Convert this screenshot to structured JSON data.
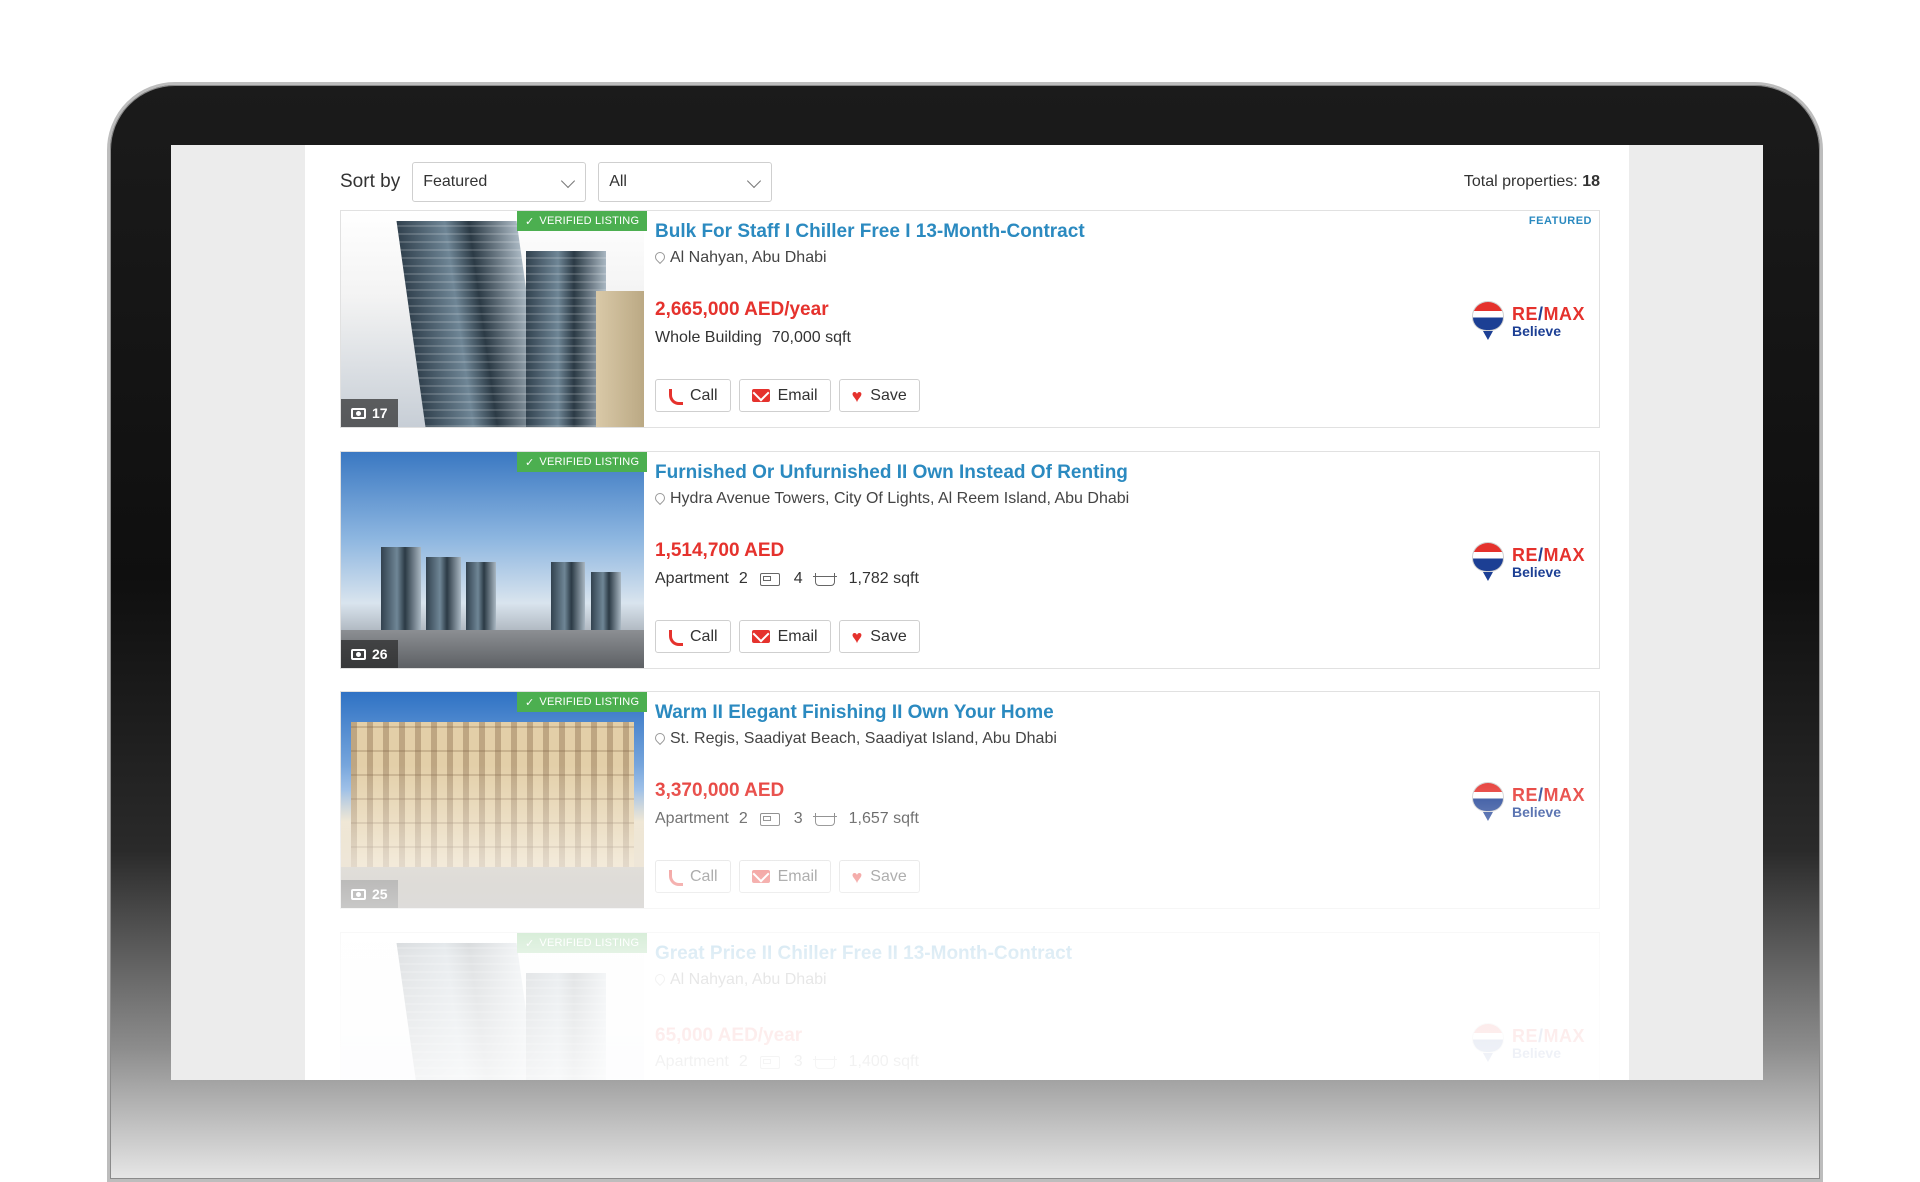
{
  "toolbar": {
    "sort_label": "Sort by",
    "sort_value": "Featured",
    "filter_value": "All",
    "total_label": "Total properties:",
    "total_count": "18"
  },
  "listings": [
    {
      "verified": "VERIFIED LISTING",
      "title": "Bulk For Staff I Chiller Free I 13-Month-Contract",
      "location": "Al Nahyan, Abu Dhabi",
      "price": "2,665,000 AED/year",
      "type": "Whole Building",
      "area": "70,000 sqft",
      "photos": "17",
      "featured": "FEATURED"
    },
    {
      "verified": "VERIFIED LISTING",
      "title": "Furnished Or Unfurnished II Own Instead Of Renting",
      "location": "Hydra Avenue Towers, City Of Lights, Al Reem Island, Abu Dhabi",
      "price": "1,514,700 AED",
      "type": "Apartment",
      "beds": "2",
      "baths": "4",
      "area": "1,782 sqft",
      "photos": "26"
    },
    {
      "verified": "VERIFIED LISTING",
      "title": "Warm II Elegant Finishing II Own Your Home",
      "location": "St. Regis, Saadiyat Beach, Saadiyat Island, Abu Dhabi",
      "price": "3,370,000 AED",
      "type": "Apartment",
      "beds": "2",
      "baths": "3",
      "area": "1,657 sqft",
      "photos": "25"
    },
    {
      "verified": "VERIFIED LISTING",
      "title": "Great Price II Chiller Free II 13-Month-Contract",
      "location": "Al Nahyan, Abu Dhabi",
      "price": "65,000 AED/year",
      "type": "Apartment",
      "beds": "2",
      "baths": "3",
      "area": "1,400 sqft"
    }
  ],
  "actions": {
    "call": "Call",
    "email": "Email",
    "save": "Save"
  },
  "brand": {
    "name_left": "RE",
    "name_slash": "/",
    "name_right": "MAX",
    "tagline": "Believe",
    "red": "#e5322d",
    "blue": "#1c3f94"
  },
  "colors": {
    "title_blue": "#2b8ac0",
    "price_red": "#e5322d",
    "verified_green": "#4caf50"
  }
}
